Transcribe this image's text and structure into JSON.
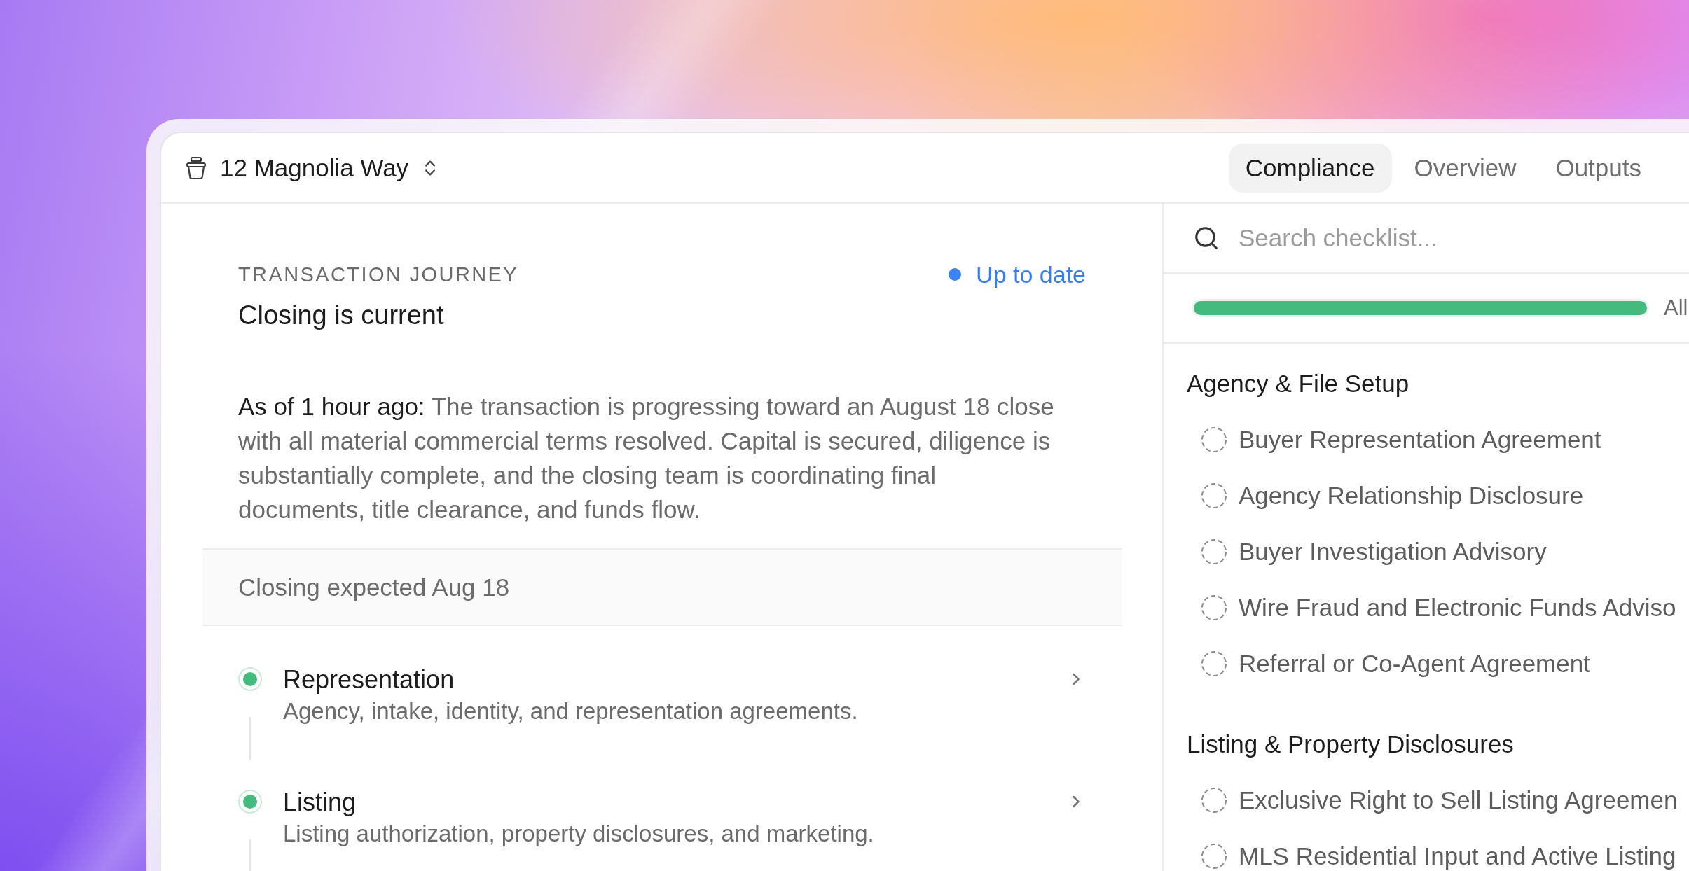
{
  "header": {
    "property": "12 Magnolia Way",
    "tabs": [
      {
        "label": "Compliance",
        "selected": true
      },
      {
        "label": "Overview",
        "selected": false
      },
      {
        "label": "Outputs",
        "selected": false
      }
    ]
  },
  "journey": {
    "eyebrow": "TRANSACTION JOURNEY",
    "status": "Up to date",
    "title": "Closing is current",
    "summary": "**As of 1 hour ago:** The transaction is progressing toward an August 18 close with all material commercial terms resolved. Capital is secured, diligence is substantially complete, and the closing team is coordinating final documents, title clearance, and funds flow.",
    "closing_note": "Closing expected Aug 18",
    "steps": [
      {
        "title": "Representation",
        "description": "Agency, intake, identity, and representation agreements.",
        "complete": true
      },
      {
        "title": "Listing",
        "description": "Listing authorization, property disclosures, and marketing.",
        "complete": true
      }
    ]
  },
  "checklist": {
    "search": {
      "placeholder": "Search checklist..."
    },
    "progress": {
      "level": 1,
      "label": "All"
    },
    "sections": [
      {
        "title": "Agency & File Setup",
        "items": [
          {
            "label": "Buyer Representation Agreement",
            "checked": false
          },
          {
            "label": "Agency Relationship Disclosure",
            "checked": false
          },
          {
            "label": "Buyer Investigation Advisory",
            "checked": false
          },
          {
            "label": "Wire Fraud and Electronic Funds Adviso",
            "checked": false
          },
          {
            "label": "Referral or Co-Agent Agreement",
            "checked": false
          }
        ]
      },
      {
        "title": "Listing & Property Disclosures",
        "items": [
          {
            "label": "Exclusive Right to Sell Listing Agreemen",
            "checked": false
          },
          {
            "label": "MLS Residential Input and Active Listing",
            "checked": false
          }
        ]
      }
    ]
  }
}
